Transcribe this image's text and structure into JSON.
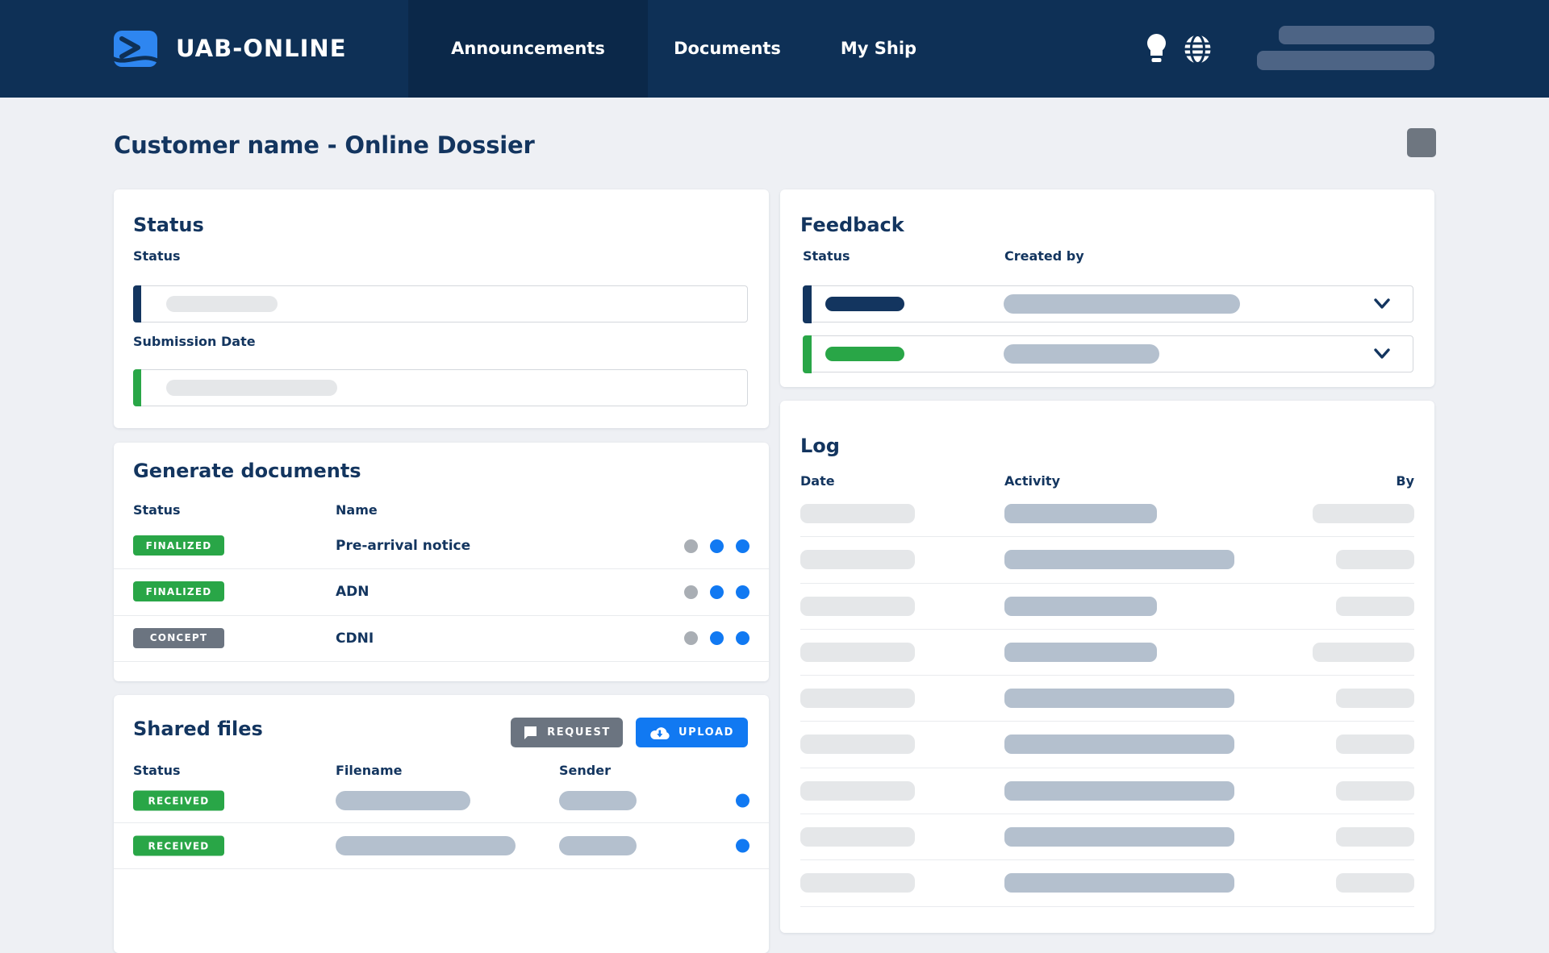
{
  "header": {
    "brand": "UAB-ONLINE",
    "nav": [
      {
        "label": "Announcements",
        "active": true
      },
      {
        "label": "Documents",
        "active": false
      },
      {
        "label": "My Ship",
        "active": false
      }
    ],
    "icons": {
      "bulb": "lightbulb-icon",
      "globe": "globe-icon"
    }
  },
  "page": {
    "title": "Customer name - Online Dossier"
  },
  "status_card": {
    "title": "Status",
    "status_label": "Status",
    "submission_label": "Submission Date"
  },
  "generate_documents": {
    "title": "Generate documents",
    "col_status": "Status",
    "col_name": "Name",
    "rows": [
      {
        "status": "FINALIZED",
        "name": "Pre-arrival notice"
      },
      {
        "status": "FINALIZED",
        "name": "ADN"
      },
      {
        "status": "CONCEPT",
        "name": "CDNI"
      }
    ]
  },
  "shared_files": {
    "title": "Shared files",
    "request_label": "REQUEST",
    "upload_label": "UPLOAD",
    "icons": {
      "request": "message-icon",
      "upload": "cloud-upload-icon"
    },
    "col_status": "Status",
    "col_filename": "Filename",
    "col_sender": "Sender",
    "rows": [
      {
        "status": "RECEIVED"
      },
      {
        "status": "RECEIVED"
      }
    ]
  },
  "feedback": {
    "title": "Feedback",
    "col_status": "Status",
    "col_created": "Created by",
    "rows": [
      {
        "accent": "navy"
      },
      {
        "accent": "green"
      }
    ]
  },
  "log": {
    "title": "Log",
    "col_date": "Date",
    "col_activity": "Activity",
    "col_by": "By",
    "row_count": 9
  },
  "colors": {
    "header_navy": "#0e3056",
    "active_tab_navy": "#0b2849",
    "brand_blue": "#2e86f0",
    "accent_blue": "#1179f2",
    "status_green": "#29a647",
    "neutral_grey": "#6b7480",
    "text_navy": "#13355f",
    "skeleton_slate": "#b4c0ce",
    "skeleton_light": "#e5e7e9"
  }
}
